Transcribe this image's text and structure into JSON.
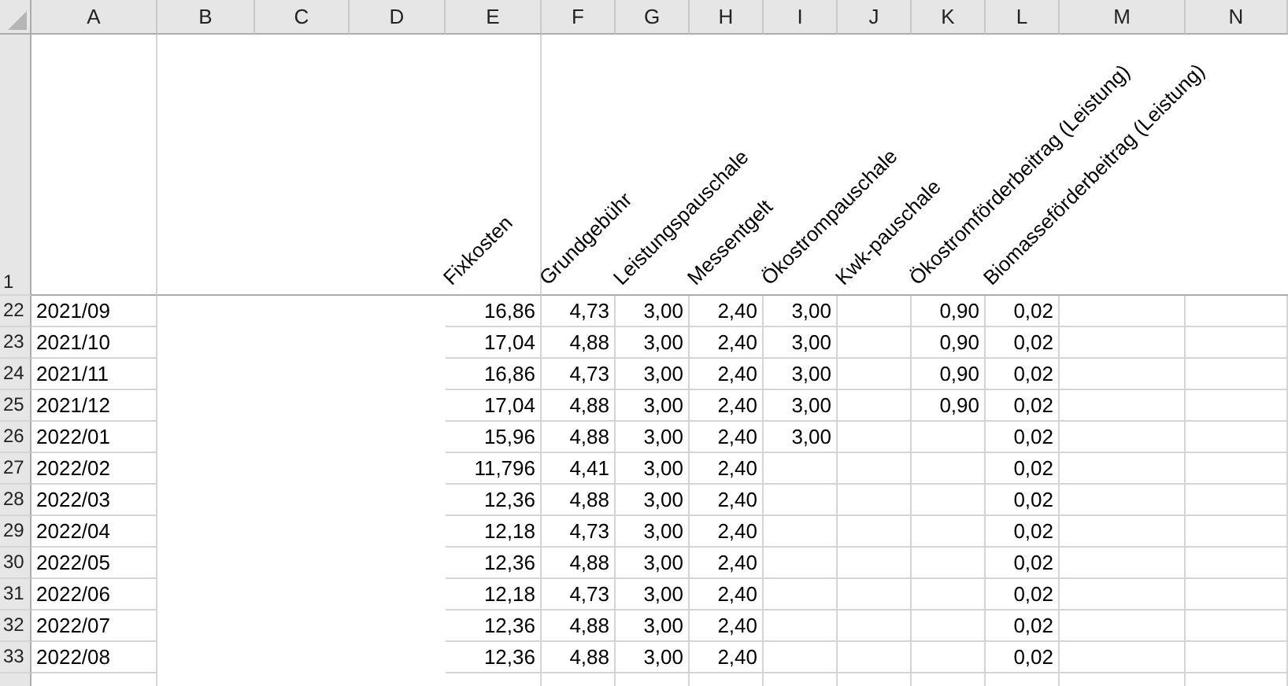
{
  "columns": [
    {
      "letter": "A"
    },
    {
      "letter": "B"
    },
    {
      "letter": "C"
    },
    {
      "letter": "D"
    },
    {
      "letter": "E",
      "heading": "Fixkosten"
    },
    {
      "letter": "F",
      "heading": "Grundgebühr"
    },
    {
      "letter": "G",
      "heading": "Leistungspauschale"
    },
    {
      "letter": "H",
      "heading": "Messentgelt"
    },
    {
      "letter": "I",
      "heading": "Ökostrompauschale"
    },
    {
      "letter": "J",
      "heading": "Kwk-pauschale"
    },
    {
      "letter": "K",
      "heading": "Ökostromförderbeitrag (Leistung)"
    },
    {
      "letter": "L",
      "heading": "Biomasseförderbeitrag (Leistung)"
    },
    {
      "letter": "M"
    },
    {
      "letter": "N"
    }
  ],
  "header_row": {
    "number": "1"
  },
  "rows": [
    {
      "number": "22",
      "cells": {
        "A": "2021/09",
        "E": "16,86",
        "F": "4,73",
        "G": "3,00",
        "H": "2,40",
        "I": "3,00",
        "K": "0,90",
        "L": "0,02"
      }
    },
    {
      "number": "23",
      "cells": {
        "A": "2021/10",
        "E": "17,04",
        "F": "4,88",
        "G": "3,00",
        "H": "2,40",
        "I": "3,00",
        "K": "0,90",
        "L": "0,02"
      }
    },
    {
      "number": "24",
      "cells": {
        "A": "2021/11",
        "E": "16,86",
        "F": "4,73",
        "G": "3,00",
        "H": "2,40",
        "I": "3,00",
        "K": "0,90",
        "L": "0,02"
      }
    },
    {
      "number": "25",
      "cells": {
        "A": "2021/12",
        "E": "17,04",
        "F": "4,88",
        "G": "3,00",
        "H": "2,40",
        "I": "3,00",
        "K": "0,90",
        "L": "0,02"
      }
    },
    {
      "number": "26",
      "cells": {
        "A": "2022/01",
        "E": "15,96",
        "F": "4,88",
        "G": "3,00",
        "H": "2,40",
        "I": "3,00",
        "L": "0,02"
      }
    },
    {
      "number": "27",
      "cells": {
        "A": "2022/02",
        "E": "11,796",
        "F": "4,41",
        "G": "3,00",
        "H": "2,40",
        "L": "0,02"
      }
    },
    {
      "number": "28",
      "cells": {
        "A": "2022/03",
        "E": "12,36",
        "F": "4,88",
        "G": "3,00",
        "H": "2,40",
        "L": "0,02"
      }
    },
    {
      "number": "29",
      "cells": {
        "A": "2022/04",
        "E": "12,18",
        "F": "4,73",
        "G": "3,00",
        "H": "2,40",
        "L": "0,02"
      }
    },
    {
      "number": "30",
      "cells": {
        "A": "2022/05",
        "E": "12,36",
        "F": "4,88",
        "G": "3,00",
        "H": "2,40",
        "L": "0,02"
      }
    },
    {
      "number": "31",
      "cells": {
        "A": "2022/06",
        "E": "12,18",
        "F": "4,73",
        "G": "3,00",
        "H": "2,40",
        "L": "0,02"
      }
    },
    {
      "number": "32",
      "cells": {
        "A": "2022/07",
        "E": "12,36",
        "F": "4,88",
        "G": "3,00",
        "H": "2,40",
        "L": "0,02"
      }
    },
    {
      "number": "33",
      "cells": {
        "A": "2022/08",
        "E": "12,36",
        "F": "4,88",
        "G": "3,00",
        "H": "2,40",
        "L": "0,02"
      }
    }
  ]
}
